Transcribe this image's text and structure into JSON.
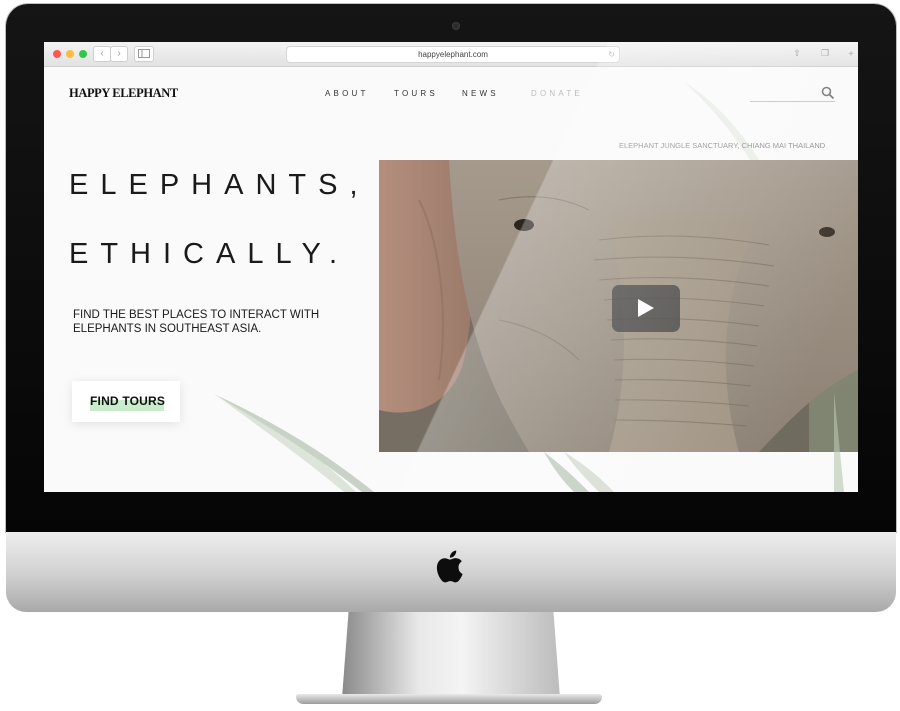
{
  "browser": {
    "url": "happyelephant.com",
    "back_glyph": "‹",
    "forward_glyph": "›",
    "reload_glyph": "↻",
    "share_glyph": "⇧",
    "tabs_glyph": "❐",
    "newtab_glyph": "+"
  },
  "site": {
    "logo": "HAPPY ELEPHANT",
    "nav": {
      "about": "ABOUT",
      "tours": "TOURS",
      "news": "NEWS",
      "donate": "DONATE"
    },
    "location_caption": "ELEPHANT JUNGLE SANCTUARY, CHIANG MAI THAILAND",
    "headline_line1": "ELEPHANTS,",
    "headline_line2": "ETHICALLY.",
    "subtext_line1": "FIND THE BEST PLACES TO INTERACT WITH",
    "subtext_line2": "ELEPHANTS IN SOUTHEAST ASIA.",
    "cta_label": "FIND TOURS"
  },
  "colors": {
    "cta_highlight": "#c9eccb",
    "nav_donate": "#bdbdbd",
    "traffic_red": "#fc5753",
    "traffic_yellow": "#fdbc40",
    "traffic_green": "#33c748"
  },
  "icons": [
    "apple-logo-icon",
    "search-icon",
    "play-icon",
    "share-icon",
    "tabs-icon",
    "sidebar-icon",
    "reload-icon"
  ]
}
